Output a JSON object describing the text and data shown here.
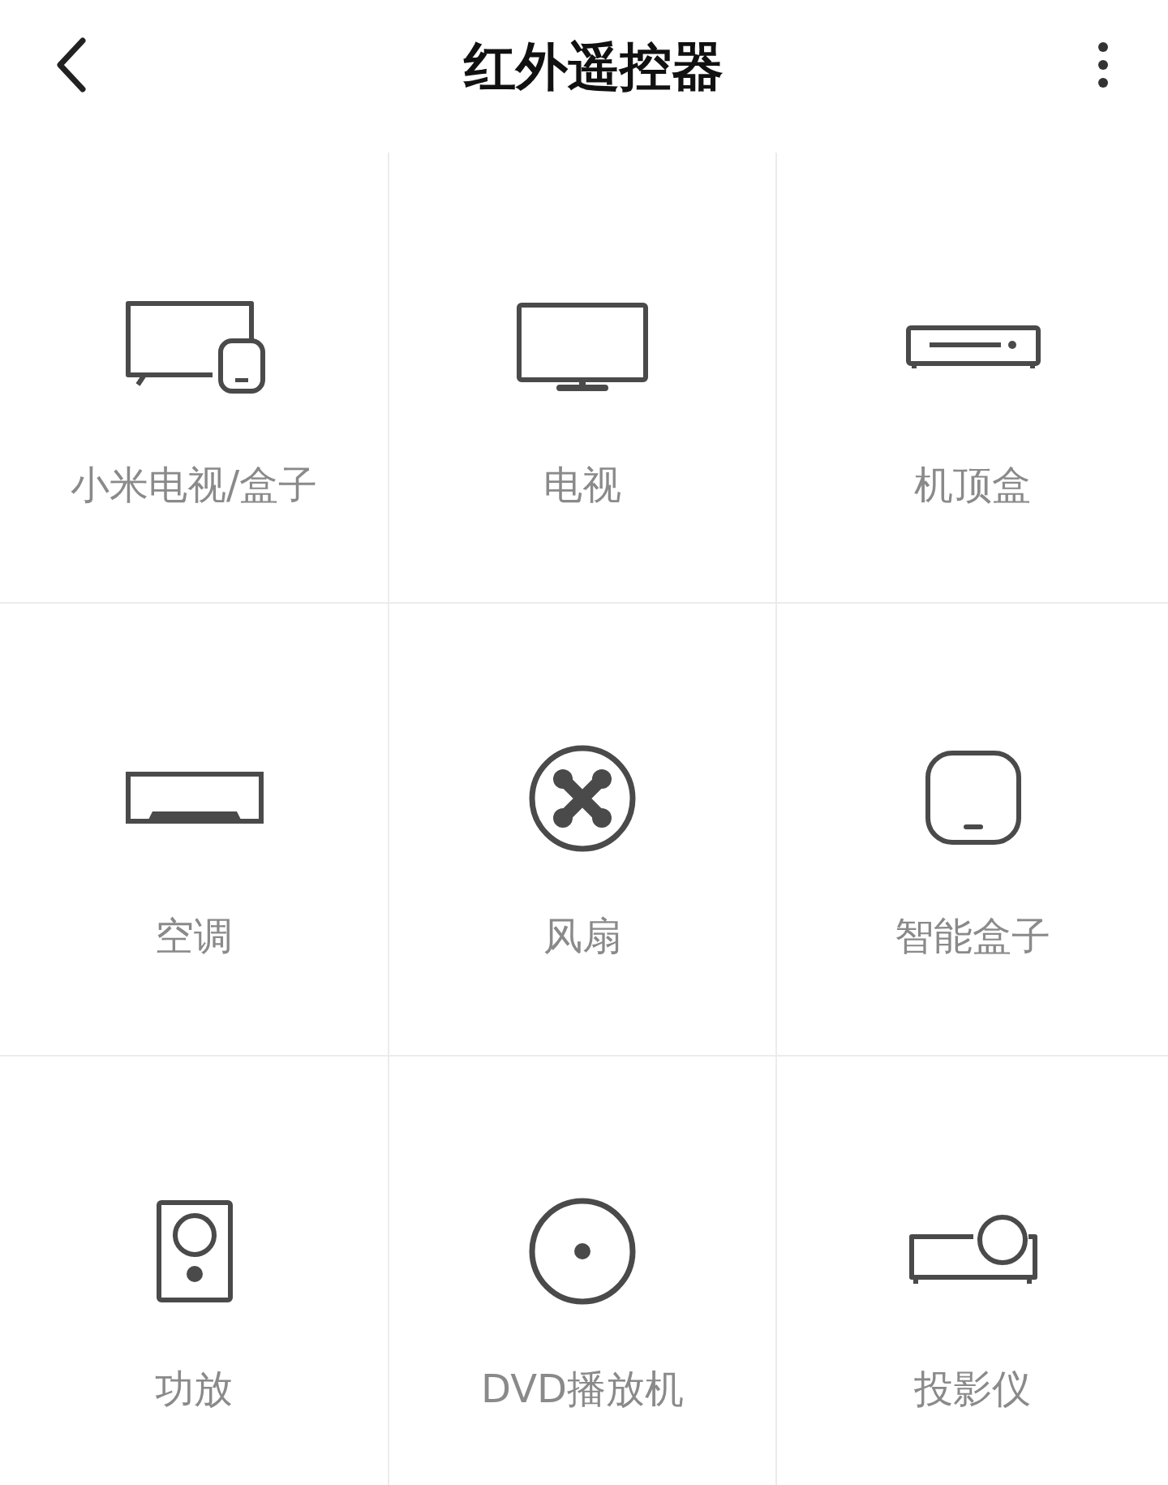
{
  "header": {
    "title": "红外遥控器"
  },
  "devices": [
    {
      "kind": "mitv",
      "label": "小米电视/盒子"
    },
    {
      "kind": "tv",
      "label": "电视"
    },
    {
      "kind": "settopbox",
      "label": "机顶盒"
    },
    {
      "kind": "aircon",
      "label": "空调"
    },
    {
      "kind": "fan",
      "label": "风扇"
    },
    {
      "kind": "smartbox",
      "label": "智能盒子"
    },
    {
      "kind": "speaker",
      "label": "功放"
    },
    {
      "kind": "dvd",
      "label": "DVD播放机"
    },
    {
      "kind": "projector",
      "label": "投影仪"
    }
  ]
}
